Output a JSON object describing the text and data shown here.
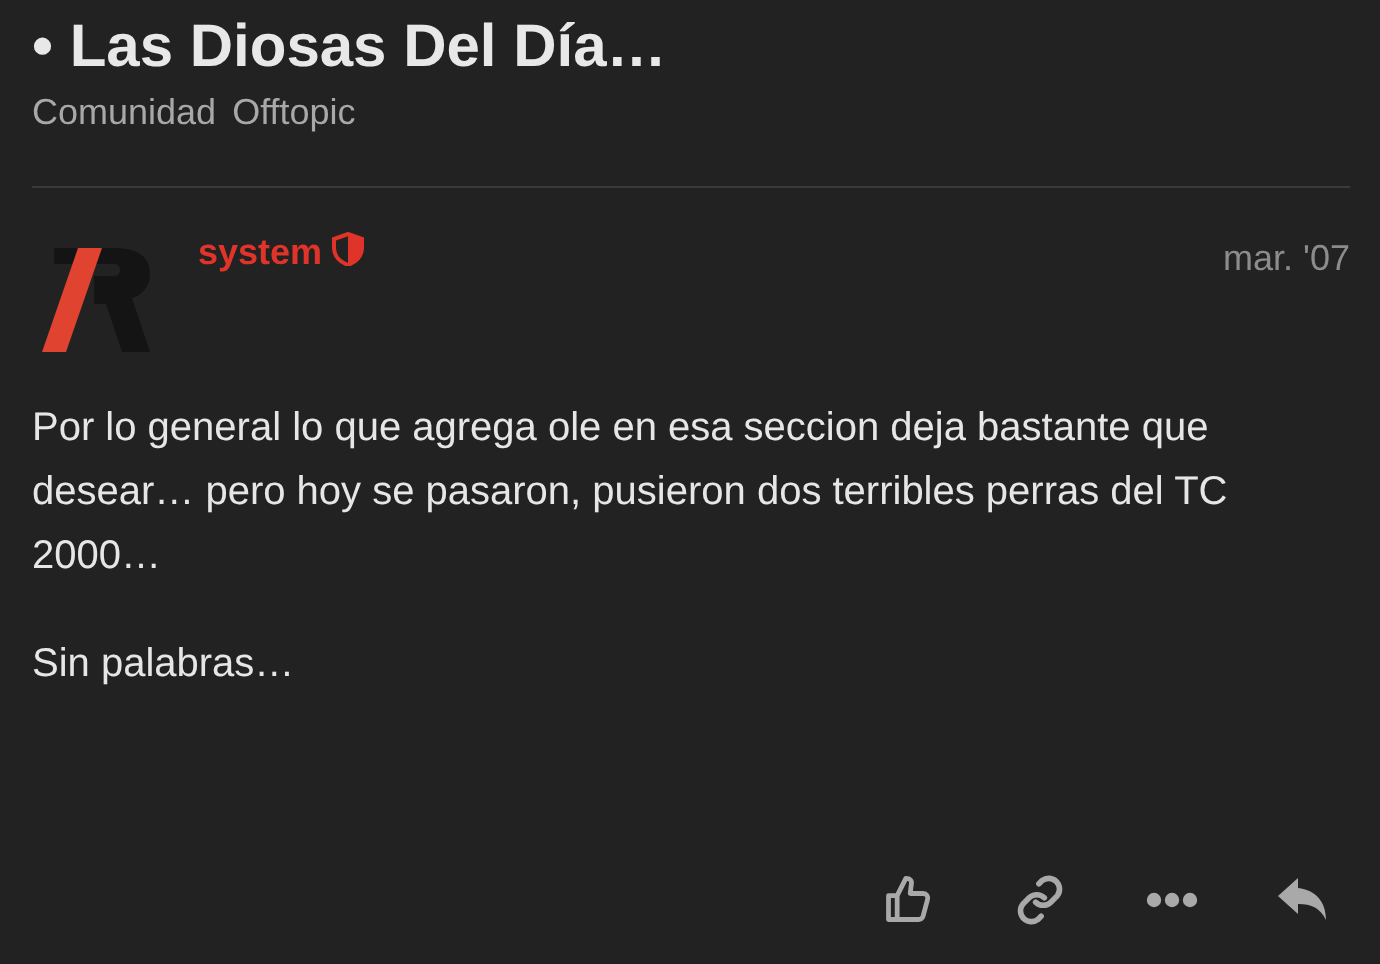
{
  "topic": {
    "title": "• Las Diosas Del Día…",
    "tags": [
      "Comunidad",
      "Offtopic"
    ]
  },
  "post": {
    "author": "system",
    "date": "mar. '07",
    "paragraphs": [
      "Por lo general lo que agrega ole en esa seccion deja bastante que desear… pero hoy se pasaron, pusieron dos terribles perras del TC 2000…",
      "Sin palabras…"
    ],
    "actions": [
      {
        "kind": "like"
      },
      {
        "kind": "link"
      },
      {
        "kind": "more"
      },
      {
        "kind": "reply"
      }
    ]
  }
}
